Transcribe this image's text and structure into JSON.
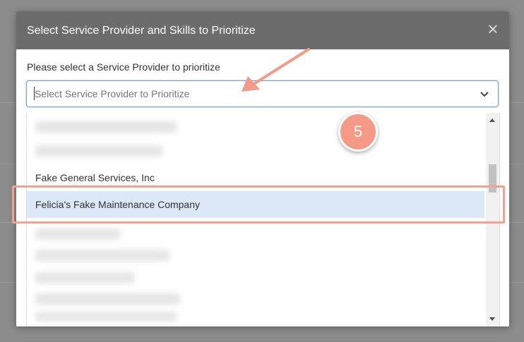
{
  "modal": {
    "title": "Select Service Provider and Skills to Prioritize",
    "close_label": "×"
  },
  "form": {
    "label": "Please select a Service Provider to prioritize",
    "select_placeholder": "Select Service Provider to Prioritize"
  },
  "dropdown": {
    "options": [
      {
        "label": "Fake General Services, Inc",
        "selected": false
      },
      {
        "label": "Felicia's Fake Maintenance Company",
        "selected": true
      }
    ]
  },
  "annotation": {
    "step_number": "5",
    "accent_color": "#f49a86"
  },
  "colors": {
    "header_bg": "#6c6c6c",
    "select_border": "#6fa0e8",
    "selected_option_bg": "#dce8f8"
  }
}
